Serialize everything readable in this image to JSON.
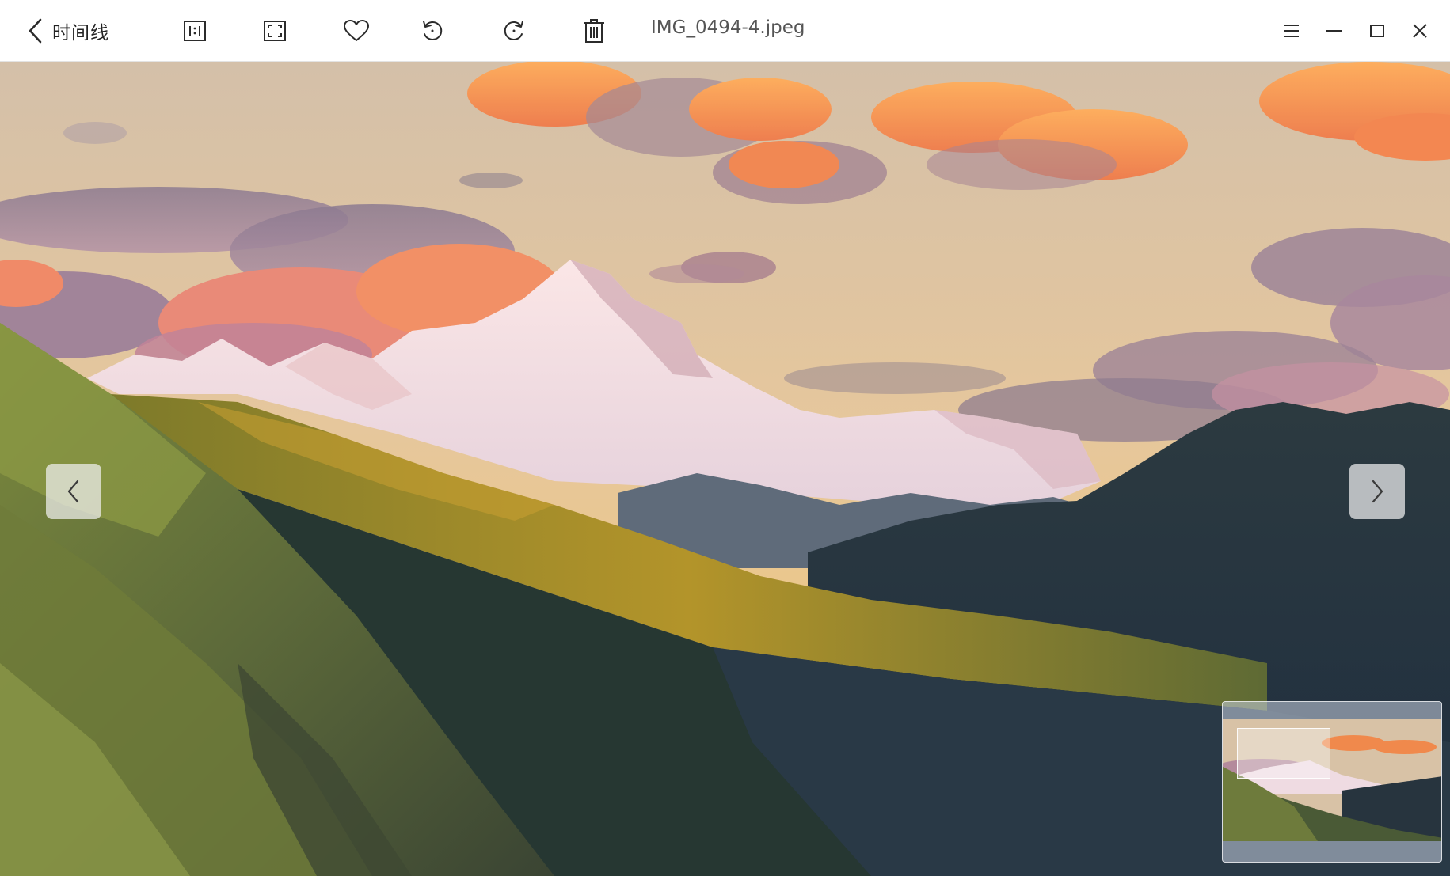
{
  "titlebar": {
    "back_label": "时间线",
    "filename": "IMG_0494-4.jpeg"
  },
  "icons": {
    "back": "chevron-left-icon",
    "actual_size": "actual-size-icon",
    "fit_window": "fit-window-icon",
    "favorite": "heart-icon",
    "rotate_left": "rotate-counterclockwise-icon",
    "rotate_right": "rotate-clockwise-icon",
    "delete": "trash-icon",
    "menu": "menu-icon",
    "minimize": "minimize-icon",
    "maximize": "maximize-icon",
    "close": "close-icon",
    "prev": "chevron-left-icon",
    "next": "chevron-right-icon"
  },
  "colors": {
    "titlebar_bg": "#ffffff",
    "icon": "#2b2b2b",
    "sky_top": "#d7c1a4",
    "sky_bottom": "#e9c58c",
    "cloud_orange": "#f58f4b",
    "cloud_purple": "#9f8296",
    "snow": "#f3d9dd",
    "forest_dark": "#27363f",
    "slope_green": "#6c7a3b"
  }
}
